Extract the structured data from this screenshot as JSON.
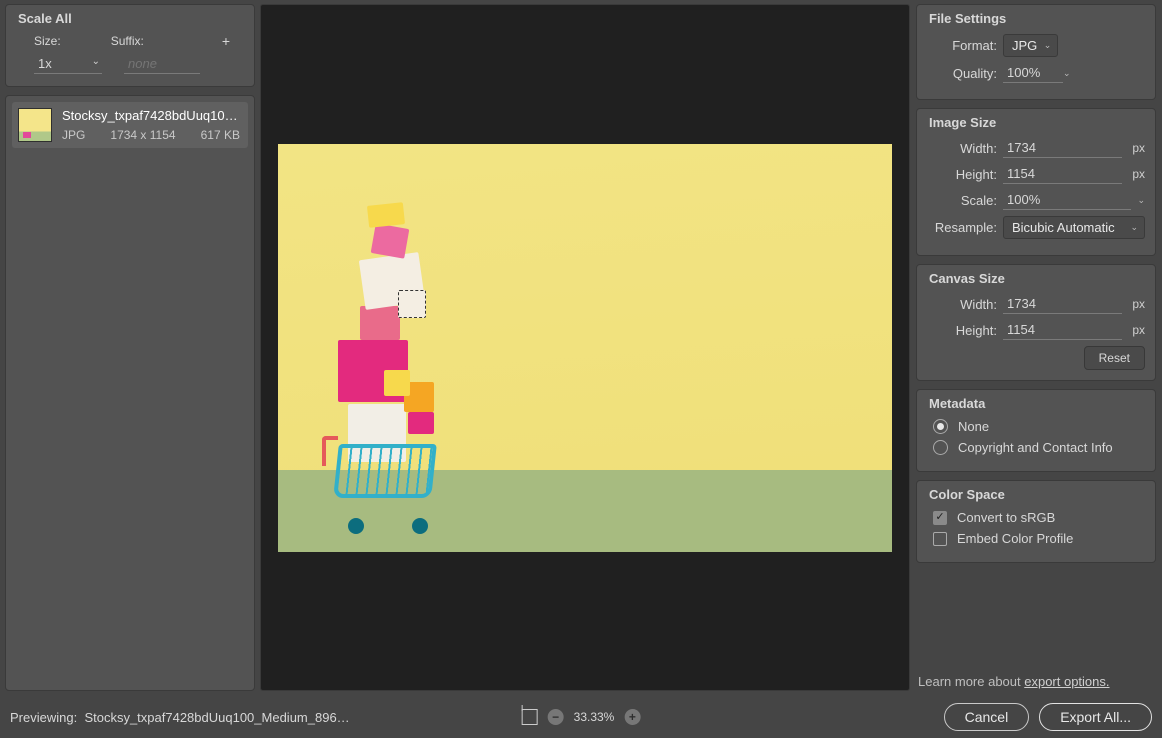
{
  "scale_all": {
    "title": "Scale All",
    "size_label": "Size:",
    "suffix_label": "Suffix:",
    "size_value": "1x",
    "suffix_placeholder": "none"
  },
  "asset": {
    "name": "Stocksy_txpaf7428bdUuq100_…",
    "format": "JPG",
    "dimensions": "1734 x 1154",
    "filesize": "617 KB"
  },
  "file_settings": {
    "title": "File Settings",
    "format_label": "Format:",
    "format_value": "JPG",
    "quality_label": "Quality:",
    "quality_value": "100%"
  },
  "image_size": {
    "title": "Image Size",
    "width_label": "Width:",
    "width_value": "1734",
    "height_label": "Height:",
    "height_value": "1154",
    "scale_label": "Scale:",
    "scale_value": "100%",
    "resample_label": "Resample:",
    "resample_value": "Bicubic Automatic",
    "unit": "px"
  },
  "canvas_size": {
    "title": "Canvas Size",
    "width_label": "Width:",
    "width_value": "1734",
    "height_label": "Height:",
    "height_value": "1154",
    "unit": "px",
    "reset_label": "Reset"
  },
  "metadata": {
    "title": "Metadata",
    "options": {
      "none": "None",
      "copyright": "Copyright and Contact Info"
    },
    "selected": "none"
  },
  "color_space": {
    "title": "Color Space",
    "convert_label": "Convert to sRGB",
    "convert_checked": true,
    "embed_label": "Embed Color Profile",
    "embed_checked": false
  },
  "learn_more": {
    "prefix": "Learn more about ",
    "link": "export options."
  },
  "bottom": {
    "previewing_label": "Previewing:",
    "previewing_file": "Stocksy_txpaf7428bdUuq100_Medium_896…",
    "zoom": "33.33%",
    "cancel": "Cancel",
    "export": "Export All..."
  }
}
